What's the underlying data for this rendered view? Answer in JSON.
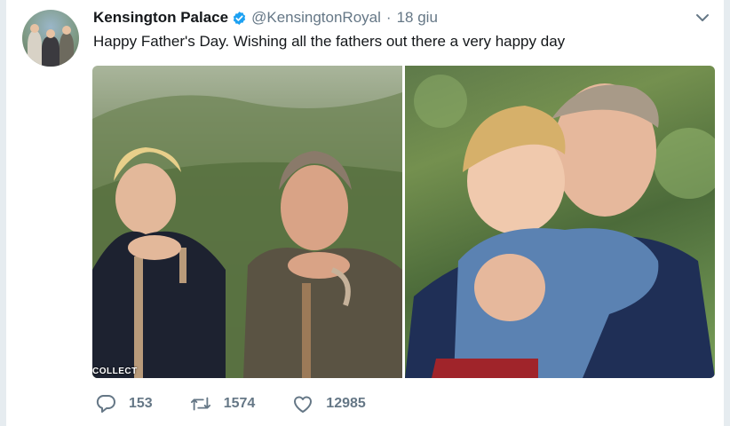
{
  "tweet": {
    "author_name": "Kensington Palace",
    "handle": "@KensingtonRoyal",
    "separator": "·",
    "time": "18 giu",
    "text": "Happy Father's Day. Wishing all the fathers out there a very happy day",
    "verified_badge_color": "#1da1f2"
  },
  "media": {
    "photo_credit": "COLLECT"
  },
  "actions": {
    "reply_count": "153",
    "retweet_count": "1574",
    "like_count": "12985"
  },
  "icons": {
    "menu": "chevron-down-icon",
    "reply": "reply-icon",
    "retweet": "retweet-icon",
    "like": "heart-icon"
  },
  "colors": {
    "text_primary": "#14171a",
    "text_secondary": "#657786",
    "page_background": "#e6ecf0"
  }
}
